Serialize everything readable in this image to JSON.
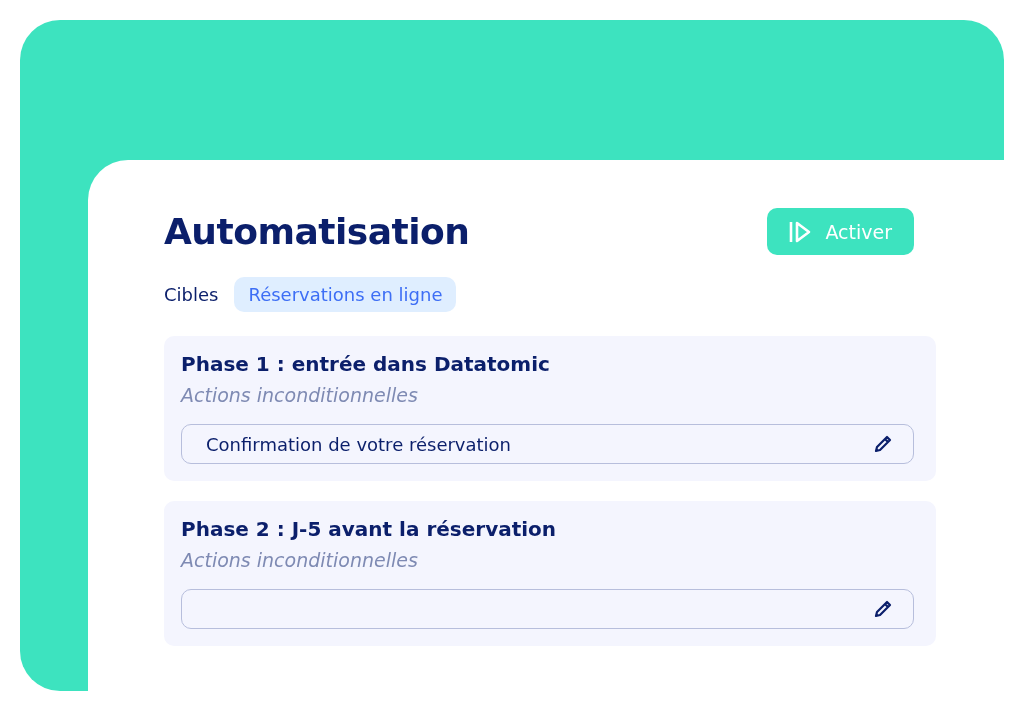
{
  "title": "Automatisation",
  "activate_button": {
    "label": "Activer"
  },
  "targets": {
    "label": "Cibles",
    "tags": [
      "Réservations en ligne"
    ]
  },
  "phases": [
    {
      "title": "Phase 1 : entrée dans Datatomic",
      "subtitle": "Actions inconditionnelles",
      "action": {
        "value": "Confirmation de votre réservation"
      }
    },
    {
      "title": "Phase 2 : J-5 avant la réservation",
      "subtitle": "Actions inconditionnelles"
    }
  ]
}
